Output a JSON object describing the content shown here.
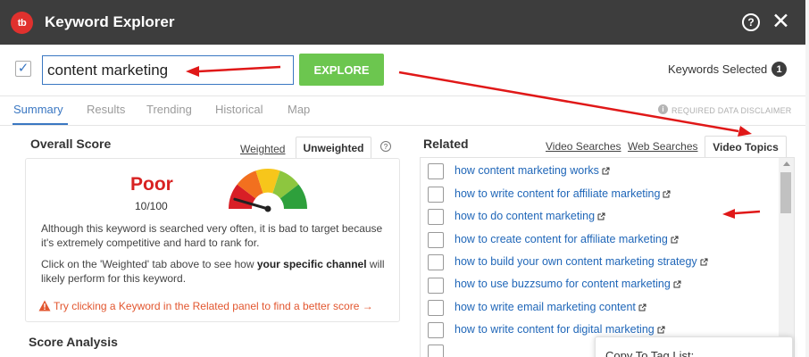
{
  "app": {
    "title": "Keyword Explorer",
    "logo_text": "tb",
    "help_icon": "question-circle-icon",
    "close_icon": "close-x-icon",
    "accent_color": "#3a77c2",
    "header_bg": "#3d3d3d"
  },
  "search": {
    "checked": true,
    "value": "content marketing",
    "explore_label": "EXPLORE",
    "explore_color": "#6cc64f"
  },
  "keywords_selected": {
    "label": "Keywords Selected",
    "count": "1"
  },
  "tabs": [
    {
      "label": "Summary",
      "active": true
    },
    {
      "label": "Results",
      "active": false
    },
    {
      "label": "Trending",
      "active": false
    },
    {
      "label": "Historical",
      "active": false
    },
    {
      "label": "Map",
      "active": false
    }
  ],
  "disclaimer": "REQUIRED DATA DISCLAIMER",
  "overall_score": {
    "title": "Overall Score",
    "weighted_label": "Weighted",
    "unweighted_label": "Unweighted",
    "active_tab": "Unweighted",
    "rating": "Poor",
    "value_text": "10/100",
    "value": 10,
    "rating_color": "#d82222",
    "description": "Although this keyword is searched very often, it is bad to target because it's extremely competitive and hard to rank for.",
    "hint_prefix": "Click on the 'Weighted' tab above to see how ",
    "hint_bold": "your specific channel",
    "hint_suffix": " will likely perform for this keyword.",
    "tip": "Try clicking a Keyword in the Related panel to find a better score →"
  },
  "score_analysis": {
    "title": "Score Analysis"
  },
  "related": {
    "title": "Related",
    "tabs": [
      "Video Searches",
      "Web Searches",
      "Video Topics"
    ],
    "active_tab": "Video Topics",
    "items": [
      "how content marketing works",
      "how to write content for affiliate marketing",
      "how to do content marketing",
      "how to create content for affiliate marketing",
      "how to build your own content marketing strategy",
      "how to use buzzsumo for content marketing",
      "how to write email marketing content",
      "how to write content for digital marketing"
    ]
  },
  "copy_popup": {
    "label": "Copy To Tag List:"
  }
}
